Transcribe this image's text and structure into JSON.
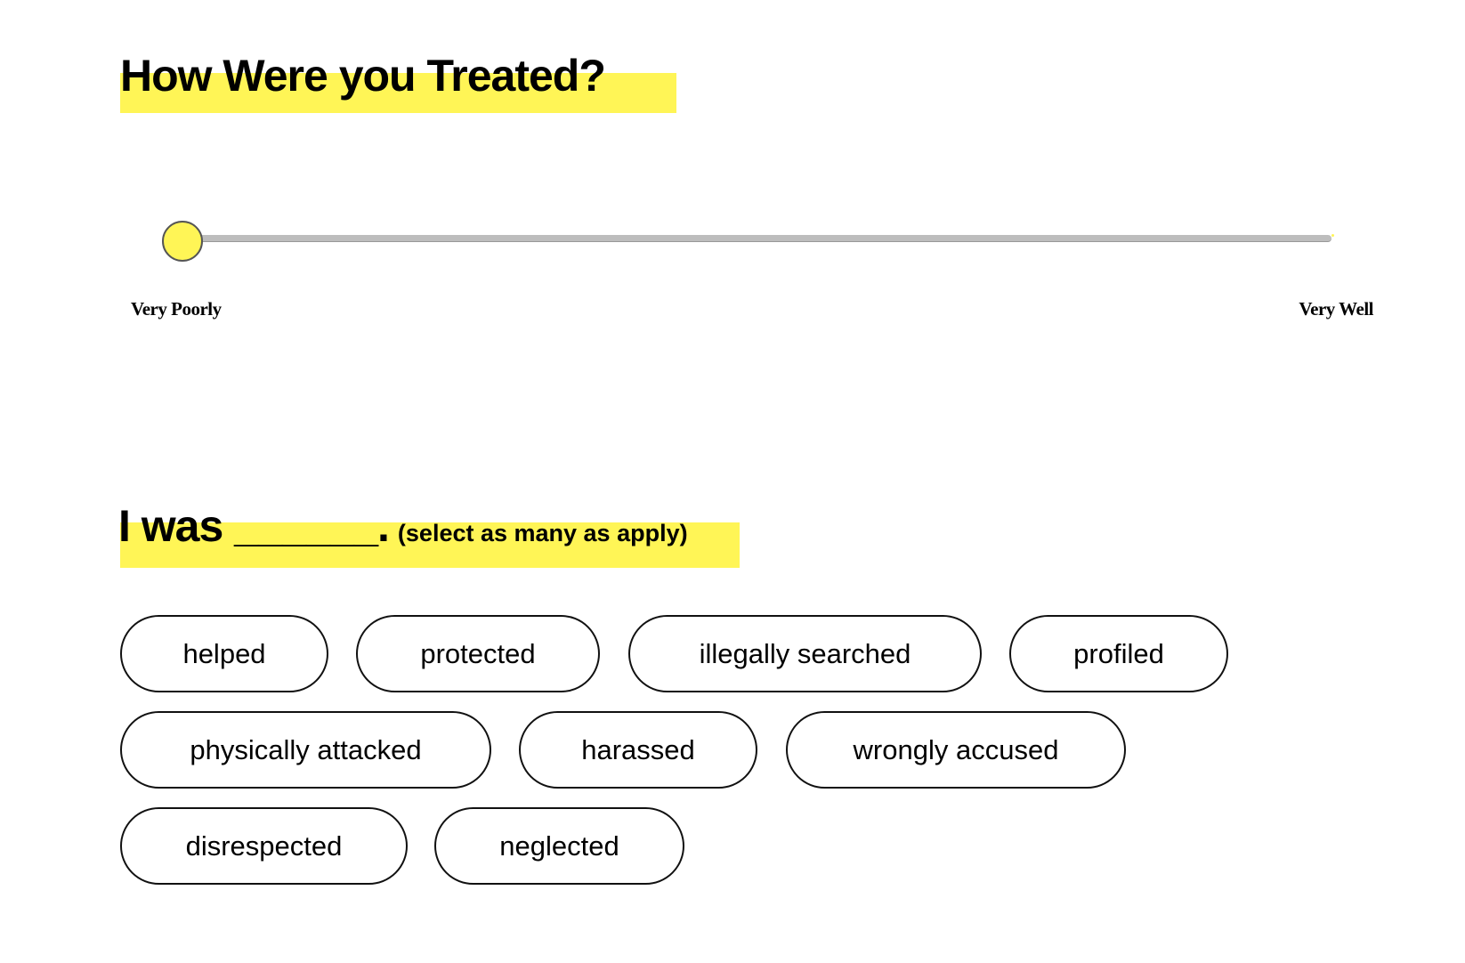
{
  "section1": {
    "title": "How Were you Treated?",
    "slider": {
      "min_label": "Very Poorly",
      "max_label": "Very Well",
      "value_fraction": 0.0
    }
  },
  "section2": {
    "title": "I was ______.",
    "hint": "(select as many as apply)",
    "options": [
      "helped",
      "protected",
      "illegally searched",
      "profiled",
      "physically attacked",
      "harassed",
      "wrongly accused",
      "disrespected",
      "neglected"
    ]
  },
  "colors": {
    "highlight": "#fff556",
    "track": "#bdbdbd",
    "pill_border": "#111111"
  }
}
